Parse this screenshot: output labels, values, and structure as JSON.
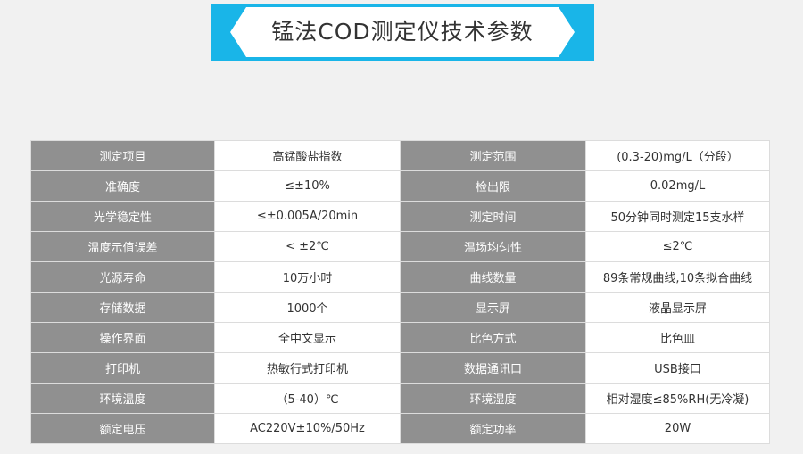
{
  "header": {
    "title": "锰法COD测定仪技术参数",
    "accent_color": "#19b5e8"
  },
  "specs": [
    [
      "测定项目",
      "高锰酸盐指数",
      "测定范围",
      "(0.3-20)mg/L（分段）"
    ],
    [
      "准确度",
      "≤±10%",
      "检出限",
      "0.02mg/L"
    ],
    [
      "光学稳定性",
      "≤±0.005A/20min",
      "测定时间",
      "50分钟同时测定15支水样"
    ],
    [
      "温度示值误差",
      "< ±2℃",
      "温场均匀性",
      "≤2℃"
    ],
    [
      "光源寿命",
      "10万小时",
      "曲线数量",
      "89条常规曲线,10条拟合曲线"
    ],
    [
      "存储数据",
      "1000个",
      "显示屏",
      "液晶显示屏"
    ],
    [
      "操作界面",
      "全中文显示",
      "比色方式",
      "比色皿"
    ],
    [
      "打印机",
      "热敏行式打印机",
      "数据通讯口",
      "USB接口"
    ],
    [
      "环境温度",
      "（5-40）℃",
      "环境湿度",
      "相对湿度≤85%RH(无冷凝)"
    ],
    [
      "额定电压",
      "AC220V±10%/50Hz",
      "额定功率",
      "20W"
    ]
  ]
}
